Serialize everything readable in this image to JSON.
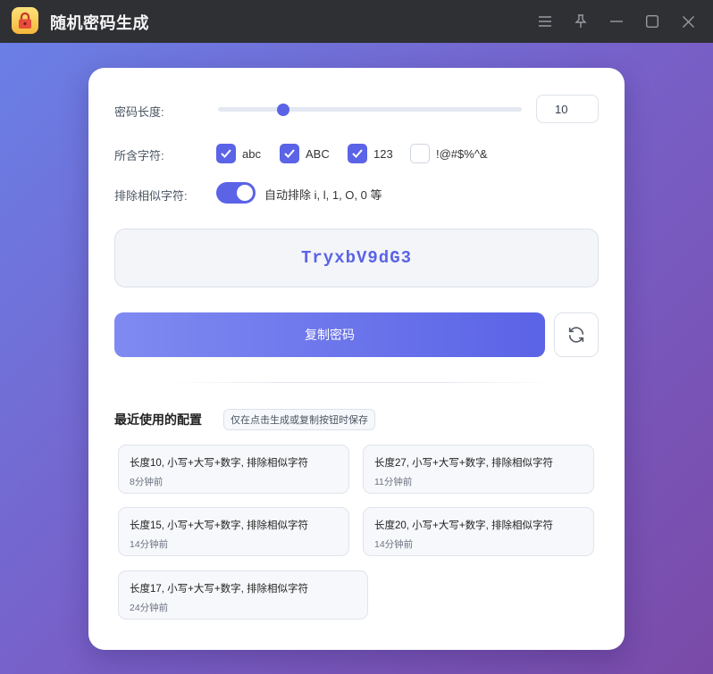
{
  "app": {
    "title": "随机密码生成",
    "accent": "#5b63e6"
  },
  "settings": {
    "length_label": "密码长度:",
    "length_value": "10",
    "length_min": 4,
    "length_max": 32,
    "chars_label": "所含字符:",
    "charsets": [
      {
        "label": "abc",
        "checked": true
      },
      {
        "label": "ABC",
        "checked": true
      },
      {
        "label": "123",
        "checked": true
      },
      {
        "label": "!@#$%^&",
        "checked": false
      }
    ],
    "exclude_label": "排除相似字符:",
    "exclude_on": true,
    "exclude_desc": "自动排除 i, l, 1, O, 0 等"
  },
  "password": {
    "value": "TryxbV9dG3"
  },
  "actions": {
    "copy_label": "复制密码"
  },
  "recent": {
    "title": "最近使用的配置",
    "note": "仅在点击生成或复制按钮时保存",
    "items": [
      {
        "desc": "长度10, 小写+大写+数字, 排除相似字符",
        "time": "8分钟前"
      },
      {
        "desc": "长度27, 小写+大写+数字, 排除相似字符",
        "time": "11分钟前"
      },
      {
        "desc": "长度15, 小写+大写+数字, 排除相似字符",
        "time": "14分钟前"
      },
      {
        "desc": "长度20, 小写+大写+数字, 排除相似字符",
        "time": "14分钟前"
      },
      {
        "desc": "长度17, 小写+大写+数字, 排除相似字符",
        "time": "24分钟前"
      }
    ]
  },
  "icons": [
    "lock-icon",
    "menu-icon",
    "pin-icon",
    "minimize-icon",
    "maximize-icon",
    "close-icon",
    "check-icon",
    "refresh-icon"
  ]
}
